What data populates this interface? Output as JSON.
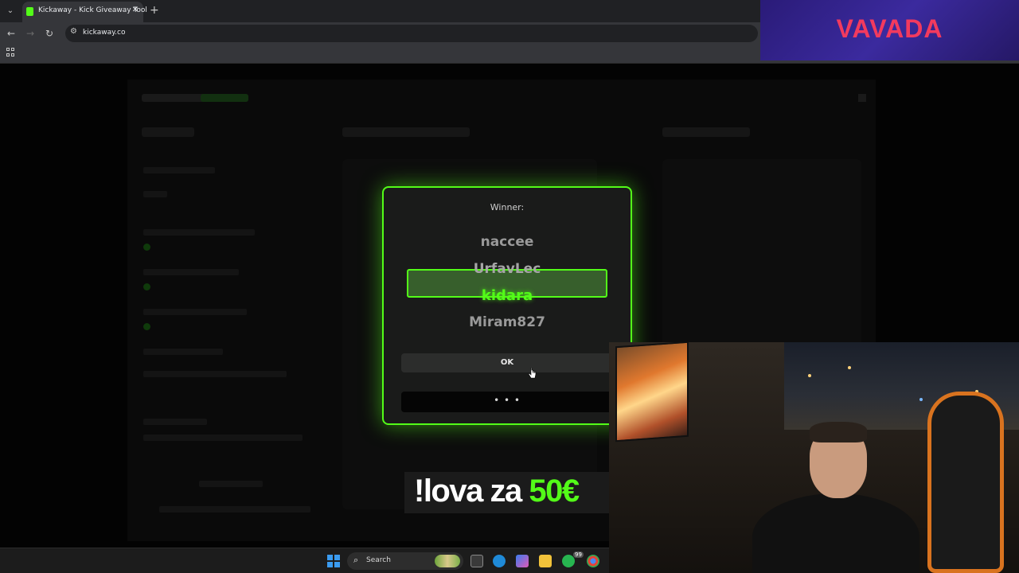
{
  "browser": {
    "tab_title": "Kickaway - Kick Giveaway Tool",
    "url": "kickaway.co",
    "new_tab_label": "+",
    "close_label": "✕"
  },
  "sponsor": {
    "logo_text": "VAVADA"
  },
  "modal": {
    "winner_label": "Winner:",
    "names": [
      "naccee",
      "UrfavLec",
      "kidara",
      "Miram827"
    ],
    "winner_name": "kidara",
    "ok_label": "OK",
    "more_label": "• • •",
    "accent_color": "#53fc18"
  },
  "overlay": {
    "caption_prefix": "!lova za ",
    "caption_amount": "50€"
  },
  "taskbar": {
    "search_label": "Search",
    "badge_count": "99"
  },
  "colors": {
    "kick_green": "#53fc18",
    "sponsor_red": "#f23a5e"
  }
}
